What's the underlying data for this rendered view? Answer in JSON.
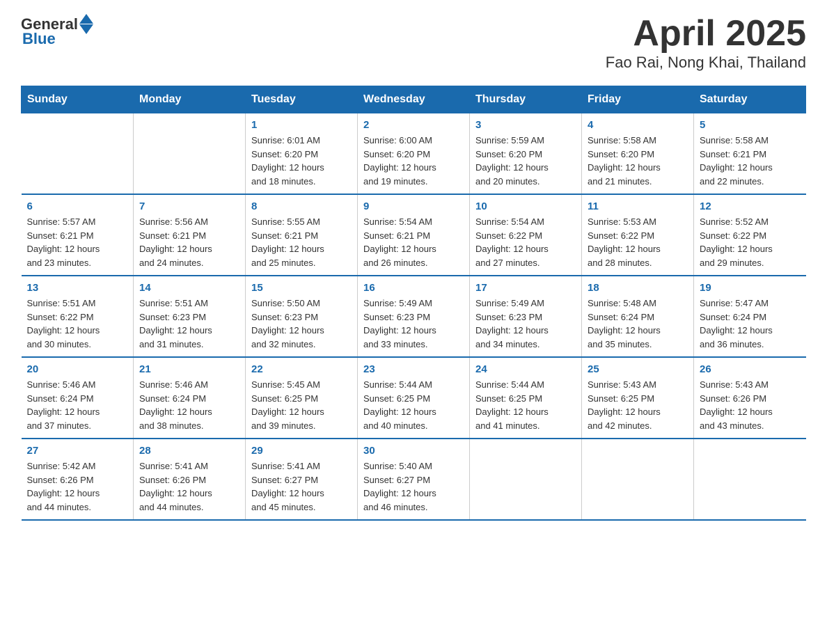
{
  "header": {
    "logo_general": "General",
    "logo_blue": "Blue",
    "title": "April 2025",
    "subtitle": "Fao Rai, Nong Khai, Thailand"
  },
  "days_of_week": [
    "Sunday",
    "Monday",
    "Tuesday",
    "Wednesday",
    "Thursday",
    "Friday",
    "Saturday"
  ],
  "weeks": [
    [
      {
        "day": "",
        "info": ""
      },
      {
        "day": "",
        "info": ""
      },
      {
        "day": "1",
        "info": "Sunrise: 6:01 AM\nSunset: 6:20 PM\nDaylight: 12 hours\nand 18 minutes."
      },
      {
        "day": "2",
        "info": "Sunrise: 6:00 AM\nSunset: 6:20 PM\nDaylight: 12 hours\nand 19 minutes."
      },
      {
        "day": "3",
        "info": "Sunrise: 5:59 AM\nSunset: 6:20 PM\nDaylight: 12 hours\nand 20 minutes."
      },
      {
        "day": "4",
        "info": "Sunrise: 5:58 AM\nSunset: 6:20 PM\nDaylight: 12 hours\nand 21 minutes."
      },
      {
        "day": "5",
        "info": "Sunrise: 5:58 AM\nSunset: 6:21 PM\nDaylight: 12 hours\nand 22 minutes."
      }
    ],
    [
      {
        "day": "6",
        "info": "Sunrise: 5:57 AM\nSunset: 6:21 PM\nDaylight: 12 hours\nand 23 minutes."
      },
      {
        "day": "7",
        "info": "Sunrise: 5:56 AM\nSunset: 6:21 PM\nDaylight: 12 hours\nand 24 minutes."
      },
      {
        "day": "8",
        "info": "Sunrise: 5:55 AM\nSunset: 6:21 PM\nDaylight: 12 hours\nand 25 minutes."
      },
      {
        "day": "9",
        "info": "Sunrise: 5:54 AM\nSunset: 6:21 PM\nDaylight: 12 hours\nand 26 minutes."
      },
      {
        "day": "10",
        "info": "Sunrise: 5:54 AM\nSunset: 6:22 PM\nDaylight: 12 hours\nand 27 minutes."
      },
      {
        "day": "11",
        "info": "Sunrise: 5:53 AM\nSunset: 6:22 PM\nDaylight: 12 hours\nand 28 minutes."
      },
      {
        "day": "12",
        "info": "Sunrise: 5:52 AM\nSunset: 6:22 PM\nDaylight: 12 hours\nand 29 minutes."
      }
    ],
    [
      {
        "day": "13",
        "info": "Sunrise: 5:51 AM\nSunset: 6:22 PM\nDaylight: 12 hours\nand 30 minutes."
      },
      {
        "day": "14",
        "info": "Sunrise: 5:51 AM\nSunset: 6:23 PM\nDaylight: 12 hours\nand 31 minutes."
      },
      {
        "day": "15",
        "info": "Sunrise: 5:50 AM\nSunset: 6:23 PM\nDaylight: 12 hours\nand 32 minutes."
      },
      {
        "day": "16",
        "info": "Sunrise: 5:49 AM\nSunset: 6:23 PM\nDaylight: 12 hours\nand 33 minutes."
      },
      {
        "day": "17",
        "info": "Sunrise: 5:49 AM\nSunset: 6:23 PM\nDaylight: 12 hours\nand 34 minutes."
      },
      {
        "day": "18",
        "info": "Sunrise: 5:48 AM\nSunset: 6:24 PM\nDaylight: 12 hours\nand 35 minutes."
      },
      {
        "day": "19",
        "info": "Sunrise: 5:47 AM\nSunset: 6:24 PM\nDaylight: 12 hours\nand 36 minutes."
      }
    ],
    [
      {
        "day": "20",
        "info": "Sunrise: 5:46 AM\nSunset: 6:24 PM\nDaylight: 12 hours\nand 37 minutes."
      },
      {
        "day": "21",
        "info": "Sunrise: 5:46 AM\nSunset: 6:24 PM\nDaylight: 12 hours\nand 38 minutes."
      },
      {
        "day": "22",
        "info": "Sunrise: 5:45 AM\nSunset: 6:25 PM\nDaylight: 12 hours\nand 39 minutes."
      },
      {
        "day": "23",
        "info": "Sunrise: 5:44 AM\nSunset: 6:25 PM\nDaylight: 12 hours\nand 40 minutes."
      },
      {
        "day": "24",
        "info": "Sunrise: 5:44 AM\nSunset: 6:25 PM\nDaylight: 12 hours\nand 41 minutes."
      },
      {
        "day": "25",
        "info": "Sunrise: 5:43 AM\nSunset: 6:25 PM\nDaylight: 12 hours\nand 42 minutes."
      },
      {
        "day": "26",
        "info": "Sunrise: 5:43 AM\nSunset: 6:26 PM\nDaylight: 12 hours\nand 43 minutes."
      }
    ],
    [
      {
        "day": "27",
        "info": "Sunrise: 5:42 AM\nSunset: 6:26 PM\nDaylight: 12 hours\nand 44 minutes."
      },
      {
        "day": "28",
        "info": "Sunrise: 5:41 AM\nSunset: 6:26 PM\nDaylight: 12 hours\nand 44 minutes."
      },
      {
        "day": "29",
        "info": "Sunrise: 5:41 AM\nSunset: 6:27 PM\nDaylight: 12 hours\nand 45 minutes."
      },
      {
        "day": "30",
        "info": "Sunrise: 5:40 AM\nSunset: 6:27 PM\nDaylight: 12 hours\nand 46 minutes."
      },
      {
        "day": "",
        "info": ""
      },
      {
        "day": "",
        "info": ""
      },
      {
        "day": "",
        "info": ""
      }
    ]
  ]
}
